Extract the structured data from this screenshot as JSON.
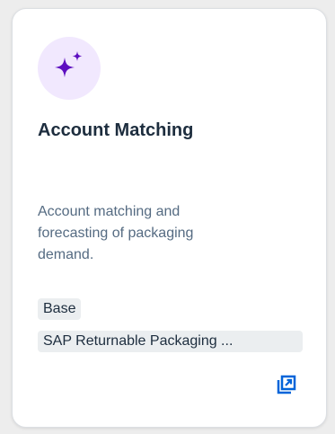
{
  "card": {
    "title": "Account Matching",
    "description": "Account matching and forecasting of packaging demand.",
    "tags": [
      "Base",
      "SAP Returnable Packaging ..."
    ],
    "icon": "sparkle-icon",
    "open_icon": "open-in-new-window-icon"
  },
  "colors": {
    "icon_background": "#f1e8fe",
    "icon_color": "#5d0ec0",
    "action_color": "#0064d9",
    "title_color": "#1d2d3e",
    "description_color": "#556b82",
    "tag_background": "#ebeef0"
  }
}
